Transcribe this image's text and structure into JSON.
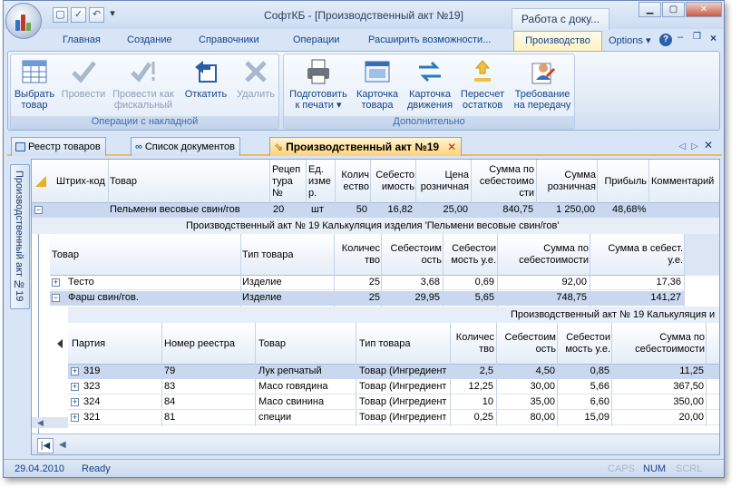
{
  "window": {
    "title": "СофтКБ - [Производственный акт №19]",
    "context_tab": "Работа с доку...",
    "min": "▁",
    "max": "▢",
    "close": "✕"
  },
  "qat": {
    "arrow": "▾"
  },
  "ribbon_tabs": [
    "Главная",
    "Создание",
    "Справочники",
    "Операции",
    "Расширить возможности...",
    "Производство"
  ],
  "options": "Options",
  "help": "?",
  "ribbon": {
    "group1": {
      "label": "Операции с накладной",
      "buttons": [
        {
          "l1": "Выбрать",
          "l2": "товар"
        },
        {
          "l1": "Провести",
          "l2": ""
        },
        {
          "l1": "Провести как",
          "l2": "фискальный"
        },
        {
          "l1": "Откатить",
          "l2": ""
        },
        {
          "l1": "Удалить",
          "l2": ""
        }
      ]
    },
    "group2": {
      "label": "Дополнительно",
      "buttons": [
        {
          "l1": "Подготовить",
          "l2": "к печати ▾"
        },
        {
          "l1": "Карточка",
          "l2": "товара"
        },
        {
          "l1": "Карточка",
          "l2": "движения"
        },
        {
          "l1": "Пересчет",
          "l2": "остатков"
        },
        {
          "l1": "Требование",
          "l2": "на передачу"
        }
      ]
    }
  },
  "doc_tabs": [
    "Реестр товаров",
    "Список документов",
    "Производственный акт №19"
  ],
  "side_tab": "Производственный акт №19",
  "grid1": {
    "headers": [
      "Штрих-код",
      "Товар",
      "Рецеп\nтура\n№",
      "Ед.\nизме\nр.",
      "Колич\nество",
      "Себесто\nимость",
      "Цена\nрозничная",
      "Сумма по\nсебестоимо\nсти",
      "Сумма\nрозничная",
      "Прибыль",
      "Комментарий"
    ],
    "row": {
      "product": "Пельмени весовые свин/гов",
      "recipe": "20",
      "unit": "шт",
      "qty": "50",
      "cost": "16,82",
      "price": "25,00",
      "sum_cost": "840,75",
      "sum_retail": "1 250,00",
      "profit": "48,68%"
    }
  },
  "grid2": {
    "caption": "Производственный акт № 19 Калькуляция изделия 'Пельмени весовые свин/гов'",
    "headers": [
      "Товар",
      "Тип товара",
      "Количес\nтво",
      "Себестоим\nость",
      "Себестои\nмость у.е.",
      "Сумма по\nсебестоимости",
      "Сумма в себест.\nу.е."
    ],
    "rows": [
      {
        "name": "Тесто",
        "type": "Изделие",
        "qty": "25",
        "cost": "3,68",
        "cost_ue": "0,69",
        "sum": "92,00",
        "sum_ue": "17,36"
      },
      {
        "name": "Фарш свин/гов.",
        "type": "Изделие",
        "qty": "25",
        "cost": "29,95",
        "cost_ue": "5,65",
        "sum": "748,75",
        "sum_ue": "141,27"
      }
    ]
  },
  "grid3": {
    "caption": "Производственный акт № 19 Калькуляция и",
    "headers": [
      "Партия",
      "Номер реестра",
      "Товар",
      "Тип товара",
      "Количес\nтво",
      "Себестоим\nость",
      "Себестои\nмость у.е.",
      "Сумма по\nсебестоимости"
    ],
    "rows": [
      {
        "batch": "319",
        "reg": "79",
        "name": "Лук репчатый",
        "type": "Товар (Ингредиент",
        "qty": "2,5",
        "cost": "4,50",
        "cost_ue": "0,85",
        "sum": "11,25"
      },
      {
        "batch": "323",
        "reg": "83",
        "name": "Масо говядина",
        "type": "Товар (Ингредиент",
        "qty": "12,25",
        "cost": "30,00",
        "cost_ue": "5,66",
        "sum": "367,50"
      },
      {
        "batch": "324",
        "reg": "84",
        "name": "Масо свинина",
        "type": "Товар (Ингредиент",
        "qty": "10",
        "cost": "35,00",
        "cost_ue": "6,60",
        "sum": "350,00"
      },
      {
        "batch": "321",
        "reg": "81",
        "name": "специи",
        "type": "Товар (Ингредиент",
        "qty": "0,25",
        "cost": "80,00",
        "cost_ue": "15,09",
        "sum": "20,00"
      }
    ]
  },
  "status": {
    "date": "29.04.2010",
    "state": "Ready",
    "caps": "CAPS",
    "num": "NUM",
    "scrl": "SCRL"
  },
  "colors": {
    "accent": "#15428b",
    "selected_row": "#c9d8ee",
    "tab_active": "#ffd27a"
  }
}
